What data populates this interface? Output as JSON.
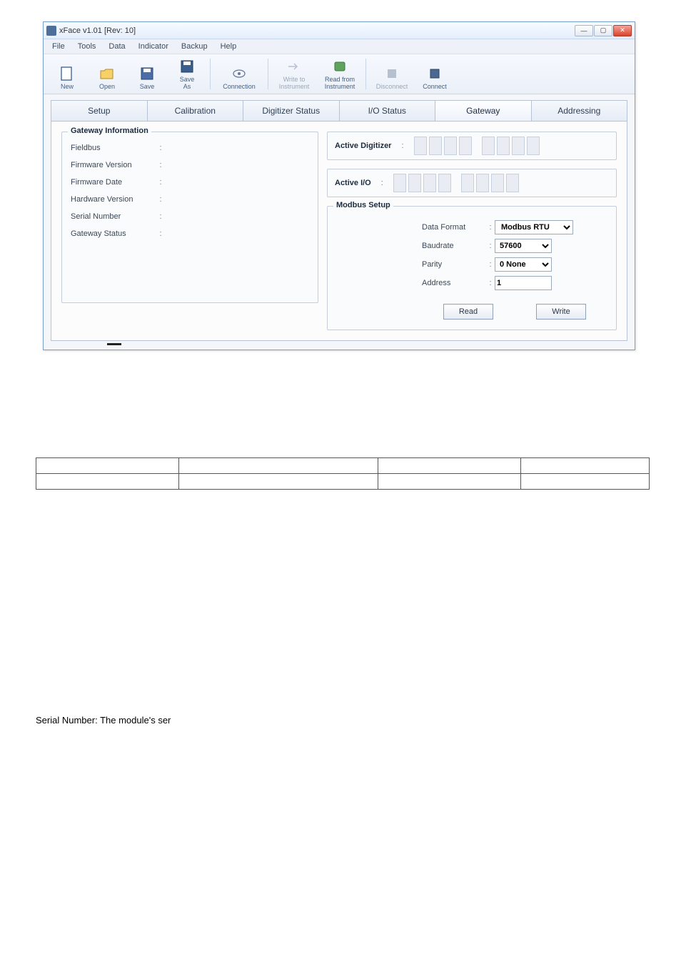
{
  "window": {
    "title": "xFace v1.01        [Rev: 10]"
  },
  "menubar": [
    "File",
    "Tools",
    "Data",
    "Indicator",
    "Backup",
    "Help"
  ],
  "toolbar": {
    "new": "New",
    "open": "Open",
    "save": "Save",
    "saveas": "Save\nAs",
    "connection": "Connection",
    "write_to": "Write to\nInstrument",
    "read_from": "Read from\nInstrument",
    "disconnect": "Disconnect",
    "connect": "Connect"
  },
  "tabs": {
    "setup": "Setup",
    "calibration": "Calibration",
    "digitizer_status": "Digitizer Status",
    "io_status": "I/O Status",
    "gateway": "Gateway",
    "addressing": "Addressing"
  },
  "gateway_info": {
    "title": "Gateway Information",
    "fieldbus": "Fieldbus",
    "firmware_version": "Firmware Version",
    "firmware_date": "Firmware Date",
    "hardware_version": "Hardware Version",
    "serial_number": "Serial Number",
    "gateway_status": "Gateway Status"
  },
  "active_digitizer": {
    "title": "Active Digitizer"
  },
  "active_io": {
    "title": "Active I/O"
  },
  "modbus": {
    "title": "Modbus Setup",
    "data_format_label": "Data Format",
    "data_format_value": "Modbus RTU",
    "baudrate_label": "Baudrate",
    "baudrate_value": "57600",
    "parity_label": "Parity",
    "parity_value": "0 None",
    "address_label": "Address",
    "address_value": "1",
    "read": "Read",
    "write": "Write"
  },
  "doc_text": "Serial Number: The module's ser"
}
